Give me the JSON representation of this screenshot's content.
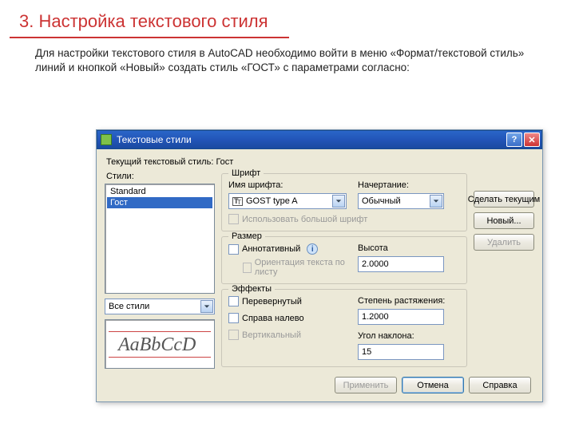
{
  "slide": {
    "title": "3. Настройка текстового стиля",
    "intro": "Для настройки текстового стиля в AutoCAD необходимо войти в меню «Формат/текстовой стиль» линий и кнопкой «Новый» создать стиль «ГОСТ» с параметрами согласно:"
  },
  "dialog": {
    "title": "Текстовые стили",
    "current_style_label": "Текущий текстовый стиль:",
    "current_style_value": "Гост",
    "styles_label": "Стили:",
    "styles": [
      "Standard",
      "Гост"
    ],
    "selected_style_index": 1,
    "filter_label": "Все стили",
    "preview_text": "AaBbCcD",
    "buttons": {
      "make_current": "Сделать текущим",
      "new": "Новый...",
      "delete": "Удалить",
      "apply": "Применить",
      "cancel": "Отмена",
      "help": "Справка"
    },
    "groups": {
      "font": {
        "legend": "Шрифт",
        "name_label": "Имя шрифта:",
        "name_value": "GOST type A",
        "style_label": "Начертание:",
        "style_value": "Обычный",
        "bigfont_label": "Использовать большой шрифт"
      },
      "size": {
        "legend": "Размер",
        "annotative_label": "Аннотативный",
        "orient_label": "Ориентация текста по листу",
        "height_label": "Высота",
        "height_value": "2.0000"
      },
      "effects": {
        "legend": "Эффекты",
        "upside_label": "Перевернутый",
        "backwards_label": "Справа налево",
        "vertical_label": "Вертикальный",
        "width_label": "Степень растяжения:",
        "width_value": "1.2000",
        "oblique_label": "Угол наклона:",
        "oblique_value": "15"
      }
    }
  }
}
